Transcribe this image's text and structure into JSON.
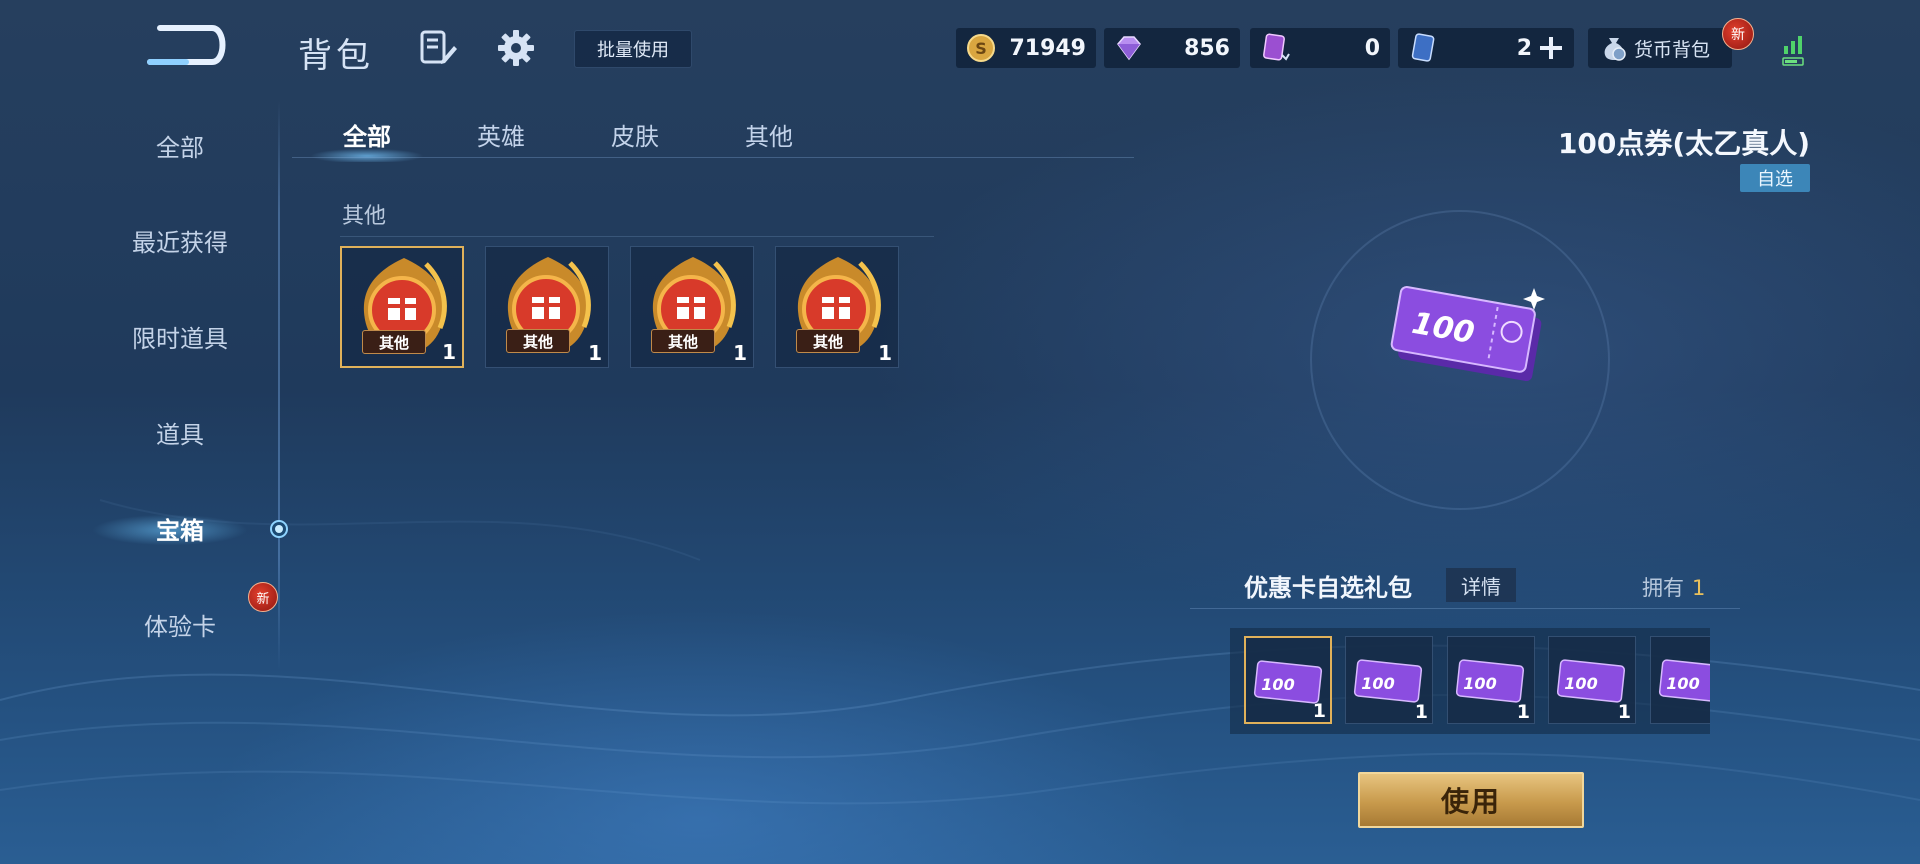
{
  "header": {
    "title": "背包",
    "batch_use_label": "批量使用",
    "wallet_label": "货币背包",
    "new_badge": "新"
  },
  "currencies": [
    {
      "icon": "gold-coin-icon",
      "value": "71949"
    },
    {
      "icon": "diamond-icon",
      "value": "856"
    },
    {
      "icon": "purple-card-icon",
      "value": "0"
    },
    {
      "icon": "blue-card-icon",
      "value": "2"
    }
  ],
  "nav": {
    "items": [
      {
        "label": "全部"
      },
      {
        "label": "最近获得"
      },
      {
        "label": "限时道具"
      },
      {
        "label": "道具"
      },
      {
        "label": "宝箱"
      },
      {
        "label": "体验卡"
      }
    ],
    "active_index": 4,
    "new_badge": "新"
  },
  "tabs": [
    {
      "label": "全部"
    },
    {
      "label": "英雄"
    },
    {
      "label": "皮肤"
    },
    {
      "label": "其他"
    }
  ],
  "section": {
    "label": "其他",
    "items": [
      {
        "tag": "其他",
        "qty": "1"
      },
      {
        "tag": "其他",
        "qty": "1"
      },
      {
        "tag": "其他",
        "qty": "1"
      },
      {
        "tag": "其他",
        "qty": "1"
      }
    ]
  },
  "detail": {
    "title": "100点券(太乙真人)",
    "tag": "自选",
    "ticket_value": "100",
    "pack_title": "优惠卡自选礼包",
    "detail_button": "详情",
    "owned_label": "拥有",
    "owned_count": "1",
    "options": [
      {
        "value": "100",
        "qty": "1"
      },
      {
        "value": "100",
        "qty": "1"
      },
      {
        "value": "100",
        "qty": "1"
      },
      {
        "value": "100",
        "qty": "1"
      },
      {
        "value": "100",
        "qty": ""
      }
    ],
    "use_button": "使用"
  },
  "colors": {
    "accent_gold": "#e0b15a",
    "active_glow": "#8fd4ff",
    "badge_red": "#c8281c",
    "ticket_purple": "#7b3fd6"
  }
}
